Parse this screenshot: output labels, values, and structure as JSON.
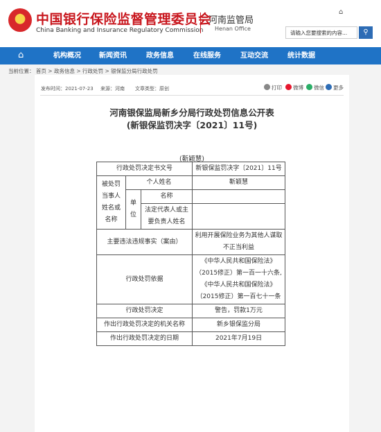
{
  "header": {
    "title_cn": "中国银行保险监督管理委员会",
    "title_en": "China Banking and Insurance Regulatory Commission",
    "office_cn": "河南监管局",
    "office_en": "Henan Office",
    "search_placeholder": "请输入您要搜索的内容...",
    "icons": [
      "home-icon",
      "search-icon",
      "print-icon",
      "weibo-icon",
      "wechat-icon",
      "more-icon"
    ]
  },
  "nav": {
    "items": [
      "机构概况",
      "新闻资讯",
      "政务信息",
      "在线服务",
      "互动交流",
      "统计数据"
    ]
  },
  "breadcrumb": {
    "prefix": "当前位置：",
    "items": [
      "首页",
      "政务信息",
      "行政处罚",
      "银保监分局行政处罚"
    ],
    "sep": ">"
  },
  "meta": {
    "date": "发布时间：2021-07-23",
    "source": "来源：河南",
    "type": "文章类型：原创"
  },
  "share": {
    "print": "打印",
    "weibo": "微博",
    "wechat": "微信",
    "more": "更多"
  },
  "document": {
    "title_line1": "河南银保监局新乡分局行政处罚信息公开表",
    "title_line2": "(新银保监罚决字〔2021〕11号)",
    "person_heading": "(靳颖慧)",
    "table": {
      "doc_number_label": "行政处罚决定书文号",
      "doc_number_value": "新银保监罚决字〔2021〕11号",
      "party_label": "被处罚当事人姓名或名称",
      "individual_label": "个人姓名",
      "individual_value": "靳颖慧",
      "unit_label": "单位",
      "name_label": "名称",
      "name_value": "",
      "rep_label": "法定代表人或主要负责人姓名",
      "rep_value": "",
      "facts_label": "主要违法违规事实（案由）",
      "facts_value": "利用开展保险业务为其他人谋取不正当利益",
      "basis_label": "行政处罚依据",
      "basis_value": "《中华人民共和国保险法》（2015修正）第一百一十六条,《中华人民共和国保险法》（2015修正）第一百七十一条",
      "decision_label": "行政处罚决定",
      "decision_value": "警告，罚款1万元",
      "organ_label": "作出行政处罚决定的机关名称",
      "organ_value": "新乡银保监分局",
      "date_label": "作出行政处罚决定的日期",
      "date_value": "2021年7月19日"
    }
  },
  "colors": {
    "brand_red": "#c8161d",
    "nav_blue": "#1f73c6"
  }
}
